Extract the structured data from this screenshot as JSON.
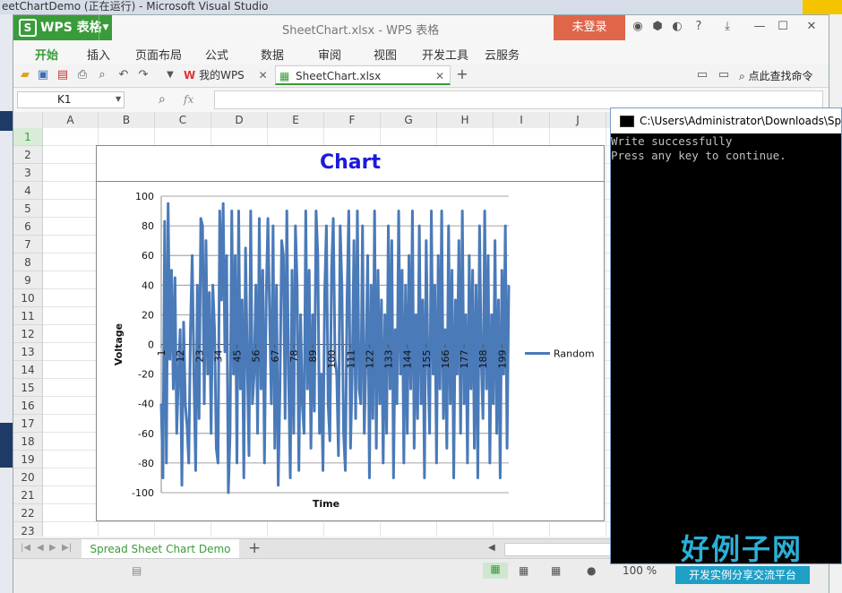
{
  "vs_window": {
    "title": "eetChartDemo (正在运行) - Microsoft Visual Studio"
  },
  "wps": {
    "app_name": "WPS 表格",
    "doc_title": "SheetChart.xlsx - WPS 表格",
    "login_label": "未登录",
    "menu": [
      "开始",
      "插入",
      "页面布局",
      "公式",
      "数据",
      "审阅",
      "视图",
      "开发工具",
      "云服务"
    ],
    "tabs": {
      "wps_home": "我的WPS",
      "file": "SheetChart.xlsx"
    },
    "search_label": "点此查找命令",
    "name_box": "K1",
    "fx_label": "fx",
    "columns": [
      "A",
      "B",
      "C",
      "D",
      "E",
      "F",
      "G",
      "H",
      "I",
      "J"
    ],
    "rows": [
      "1",
      "2",
      "3",
      "4",
      "5",
      "6",
      "7",
      "8",
      "9",
      "10",
      "11",
      "12",
      "13",
      "14",
      "15",
      "16",
      "17",
      "18",
      "19",
      "20",
      "21",
      "22",
      "23"
    ],
    "sheet_tab": "Spread Sheet Chart Demo",
    "add_sheet": "+",
    "zoom": "100 %"
  },
  "chart_data": {
    "type": "line",
    "title": "Chart",
    "xlabel": "Time",
    "ylabel": "Voltage",
    "ylim": [
      -100,
      100
    ],
    "yticks": [
      -100,
      -80,
      -60,
      -40,
      -20,
      0,
      20,
      40,
      60,
      80,
      100
    ],
    "xticks": [
      "1",
      "12",
      "23",
      "34",
      "45",
      "56",
      "67",
      "78",
      "89",
      "100",
      "111",
      "122",
      "133",
      "144",
      "155",
      "166",
      "177",
      "188",
      "199"
    ],
    "legend": "right",
    "grid": true,
    "series": [
      {
        "name": "Random",
        "color": "#4a7ab8",
        "values": [
          -40,
          -90,
          83,
          -80,
          95,
          -10,
          50,
          -30,
          45,
          -60,
          -20,
          10,
          -95,
          15,
          -40,
          -55,
          -80,
          10,
          60,
          -20,
          -85,
          40,
          -50,
          85,
          80,
          -40,
          70,
          -20,
          35,
          -60,
          40,
          10,
          -70,
          -80,
          90,
          30,
          95,
          -5,
          60,
          -100,
          -60,
          90,
          -20,
          60,
          -80,
          90,
          -30,
          30,
          -90,
          65,
          -10,
          -75,
          90,
          -40,
          -20,
          40,
          -60,
          85,
          -30,
          50,
          -80,
          30,
          85,
          20,
          -40,
          80,
          -70,
          40,
          -95,
          -30,
          70,
          60,
          -50,
          90,
          -20,
          -90,
          50,
          -60,
          80,
          40,
          -85,
          20,
          -40,
          -60,
          90,
          -30,
          50,
          -70,
          20,
          -45,
          90,
          60,
          -60,
          -20,
          -85,
          35,
          80,
          -40,
          -65,
          50,
          85,
          -10,
          -20,
          -75,
          80,
          40,
          -60,
          -85,
          30,
          90,
          -70,
          -20,
          70,
          -50,
          90,
          -30,
          -40,
          80,
          -60,
          -10,
          60,
          -90,
          40,
          -50,
          90,
          -70,
          50,
          -40,
          30,
          -80,
          20,
          -60,
          80,
          -30,
          70,
          -90,
          10,
          -40,
          90,
          -20,
          50,
          -80,
          40,
          -60,
          60,
          -30,
          90,
          -70,
          20,
          -50,
          80,
          -40,
          30,
          -90,
          70,
          -10,
          -60,
          90,
          -20,
          40,
          -80,
          60,
          -30,
          90,
          -50,
          10,
          -70,
          80,
          -40,
          50,
          -90,
          30,
          -20,
          70,
          -60,
          90,
          -40,
          20,
          -80,
          60,
          -30,
          50,
          -70,
          40,
          -90,
          80,
          -10,
          -50,
          90,
          -30,
          60,
          -80,
          20,
          -40,
          70,
          -60,
          30,
          -90,
          50,
          -20,
          80,
          -70,
          40
        ]
      }
    ]
  },
  "console": {
    "title": "C:\\Users\\Administrator\\Downloads\\Spre",
    "lines": [
      "Write successfully",
      "Press any key to continue."
    ]
  },
  "watermark": {
    "big": "好例子网",
    "small": "开发实例分享交流平台"
  }
}
